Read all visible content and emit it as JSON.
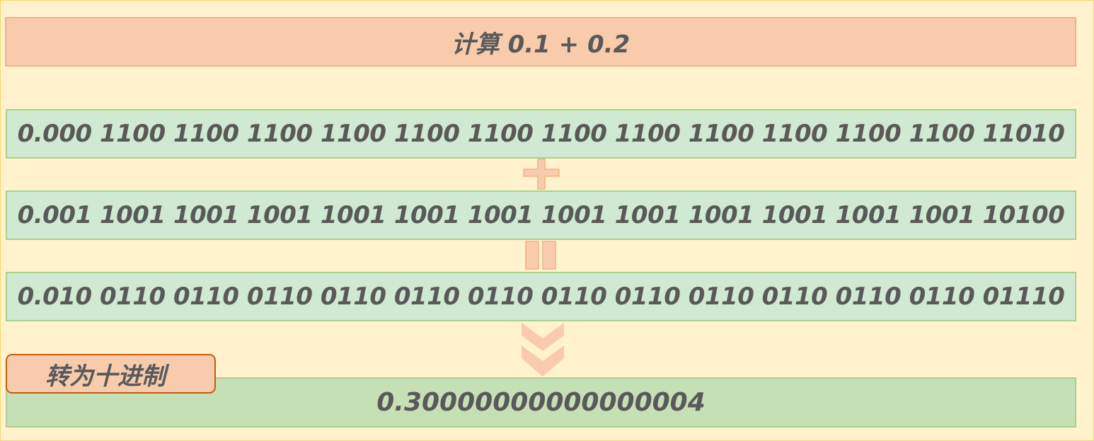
{
  "title": "计算 0.1 +  0.2",
  "rows": [
    "0.000 1100 1100 1100 1100 1100 1100 1100 1100 1100 1100 1100 1100 11010",
    "0.001 1001 1001 1001 1001 1001 1001 1001 1001 1001 1001 1001 1001 10100",
    "0.010 0110 0110 0110 0110 0110 0110 0110 0110 0110 0110 0110 0110 01110"
  ],
  "convert_label": "转为十进制",
  "result": "0.30000000000000004",
  "icons": {
    "plus": "plus-icon",
    "equals": "equals-icon",
    "down_chevron": "double-chevron-down-icon"
  },
  "colors": {
    "background": "#fff2cc",
    "title_fill": "#f8cbad",
    "row_fill": "#d0e9d2",
    "result_fill": "#c5e0b4",
    "symbol_fill": "#f8cbad",
    "text": "#595959"
  }
}
